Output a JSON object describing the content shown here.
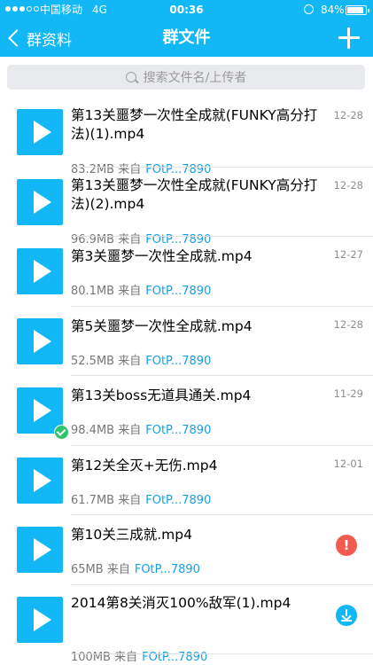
{
  "status_bar": {
    "carrier": "中国移动",
    "network": "4G",
    "time": "00:36",
    "battery": "84%",
    "battery_level": 0.84
  },
  "nav": {
    "back_label": "群资料",
    "title": "群文件"
  },
  "search": {
    "placeholder": "搜索文件名/上传者"
  },
  "files": [
    {
      "name": "第13关噩梦一次性全成就(FUNKY高分打法)(1).mp4",
      "size": "83.2MB",
      "from": "来自",
      "uploader": "FOtP...7890",
      "date": "12-28",
      "state": ""
    },
    {
      "name": "第13关噩梦一次性全成就(FUNKY高分打法)(2).mp4",
      "size": "96.9MB",
      "from": "来自",
      "uploader": "FOtP...7890",
      "date": "12-28",
      "state": ""
    },
    {
      "name": "第3关噩梦一次性全成就.mp4",
      "size": "80.1MB",
      "from": "来自",
      "uploader": "FOtP...7890",
      "date": "12-27",
      "state": ""
    },
    {
      "name": "第5关噩梦一次性全成就.mp4",
      "size": "52.5MB",
      "from": "来自",
      "uploader": "FOtP...7890",
      "date": "12-28",
      "state": ""
    },
    {
      "name": "第13关boss无道具通关.mp4",
      "size": "98.4MB",
      "from": "来自",
      "uploader": "FOtP...7890",
      "date": "11-29",
      "state": "downloaded"
    },
    {
      "name": "第12关全灭+无伤.mp4",
      "size": "61.7MB",
      "from": "来自",
      "uploader": "FOtP...7890",
      "date": "12-01",
      "state": ""
    },
    {
      "name": "第10关三成就.mp4",
      "size": "65MB",
      "from": "来自",
      "uploader": "FOtP...7890",
      "date": "",
      "state": "error"
    },
    {
      "name": "2014第8关消灭100%敌军(1).mp4",
      "size": "100MB",
      "from": "来自",
      "uploader": "FOtP...7890",
      "date": "",
      "state": "download"
    }
  ],
  "icons": {
    "error_glyph": "!"
  },
  "colors": {
    "accent": "#12b7f5",
    "success": "#2fc36b",
    "error": "#f25c50",
    "link": "#12a0e8"
  }
}
